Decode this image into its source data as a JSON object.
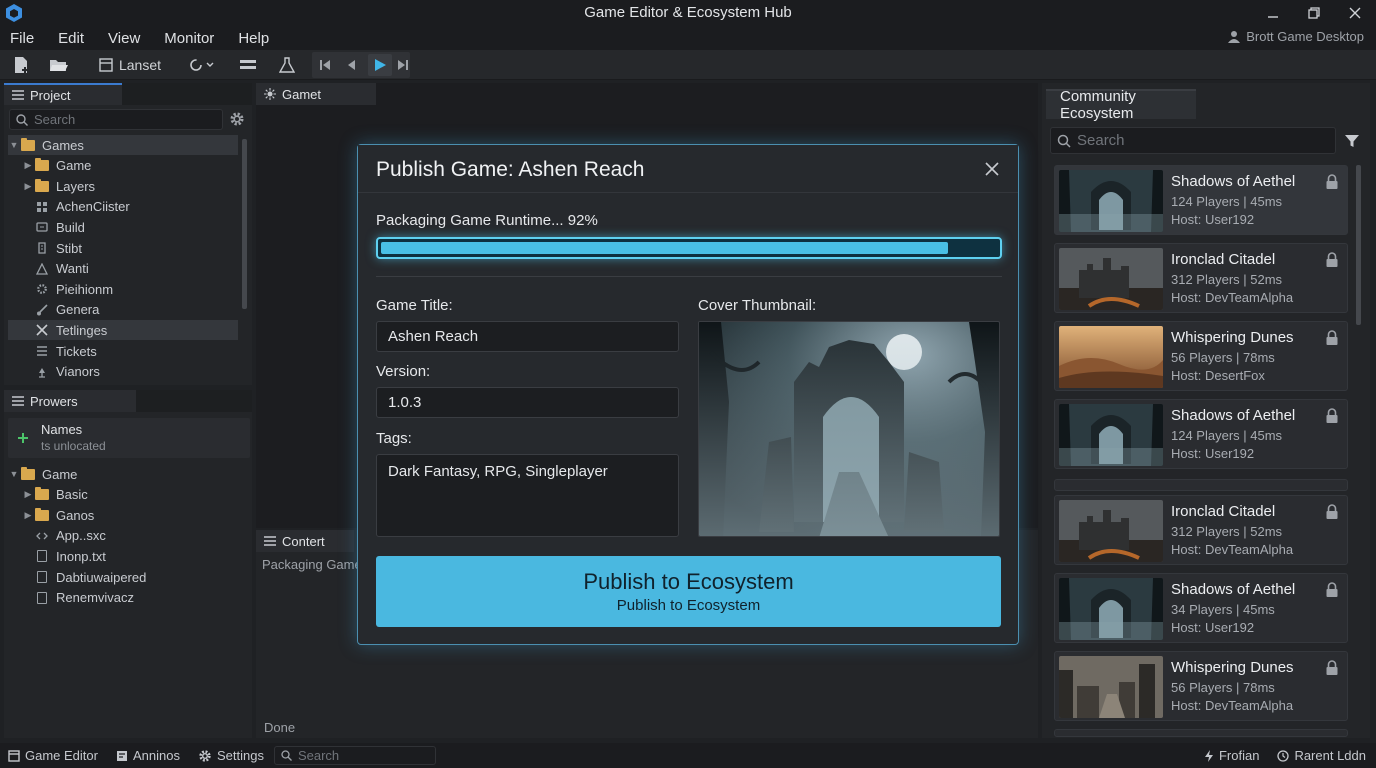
{
  "window": {
    "title": "Game Editor & Ecosystem Hub",
    "account": "Brott Game Desktop"
  },
  "menu": [
    "File",
    "Edit",
    "View",
    "Monitor",
    "Help"
  ],
  "toolbar": {
    "layout_label": "Lanset"
  },
  "project": {
    "tab": "Project",
    "search_placeholder": "Search",
    "tree": [
      {
        "label": "Games",
        "icon": "folder",
        "expanded": true,
        "selected": true
      },
      {
        "label": "Game",
        "icon": "folder"
      },
      {
        "label": "Layers",
        "icon": "folder"
      },
      {
        "label": "AchenCiister",
        "icon": "grid"
      },
      {
        "label": "Build",
        "icon": "build"
      },
      {
        "label": "Stibt",
        "icon": "script"
      },
      {
        "label": "Wanti",
        "icon": "warning"
      },
      {
        "label": "Pieihionm",
        "icon": "gear"
      },
      {
        "label": "Genera",
        "icon": "brush"
      },
      {
        "label": "Tetlinges",
        "icon": "tools",
        "selected": true
      },
      {
        "label": "Tickets",
        "icon": "list"
      },
      {
        "label": "Vianors",
        "icon": "lamp"
      }
    ]
  },
  "browser": {
    "tab": "Prowers",
    "names_card": {
      "title": "Names",
      "subtitle": "ts unlocated"
    },
    "tree": [
      {
        "label": "Game",
        "icon": "folder",
        "expanded": true
      },
      {
        "label": "Basic",
        "icon": "folder"
      },
      {
        "label": "Ganos",
        "icon": "folder"
      },
      {
        "label": "App..sxc",
        "icon": "code"
      },
      {
        "label": "Inonp.txt",
        "icon": "file"
      },
      {
        "label": "Dabtiuwaipered",
        "icon": "file"
      },
      {
        "label": "Renemvivacz",
        "icon": "file"
      }
    ]
  },
  "scene": {
    "tab": "Gamet"
  },
  "content": {
    "tab": "Contert",
    "log_line": "Packaging Game",
    "status": "Done"
  },
  "dialog": {
    "title": "Publish Game: Ashen Reach",
    "progress_label": "Packaging Game Runtime... 92%",
    "progress": 0.92,
    "game_title_label": "Game Title:",
    "game_title_value": "Ashen Reach",
    "version_label": "Version:",
    "version_value": "1.0.3",
    "tags_label": "Tags:",
    "tags_value": "Dark Fantasy, RPG, Singleplayer",
    "cover_label": "Cover Thumbnail:",
    "publish_label": "Publish to Ecosystem",
    "publish_sublabel": "Publish to Ecosystem"
  },
  "community": {
    "tab": "Community Ecosystem",
    "search_placeholder": "Search",
    "cards": [
      {
        "name": "Shadows of Aethel",
        "meta": "124 Players | 45ms",
        "host": "Host: User192",
        "thumb": "arch"
      },
      {
        "name": "Ironclad Citadel",
        "meta": "312 Players | 52ms",
        "host": "Host: DevTeamAlpha",
        "thumb": "castle"
      },
      {
        "name": "Whispering Dunes",
        "meta": "56 Players | 78ms",
        "host": "Host: DesertFox",
        "thumb": "dunes"
      },
      {
        "name": "Shadows of Aethel",
        "meta": "124 Players | 45ms",
        "host": "Host: User192",
        "thumb": "arch"
      },
      {
        "name": "Ironclad Citadel",
        "meta": "312 Players | 52ms",
        "host": "Host: DevTeamAlpha",
        "thumb": "castle"
      },
      {
        "name": "Shadows of Aethel",
        "meta": "34 Players | 45ms",
        "host": "Host: User192",
        "thumb": "arch"
      },
      {
        "name": "Whispering Dunes",
        "meta": "56 Players | 78ms",
        "host": "Host: DevTeamAlpha",
        "thumb": "ruins"
      }
    ]
  },
  "statusbar": {
    "game_editor": "Game Editor",
    "annotations": "Anninos",
    "settings": "Settings",
    "search_placeholder": "Search",
    "right1": "Frofian",
    "right2": "Rarent Lddn"
  },
  "colors": {
    "accent": "#49c0e6",
    "folder": "#d9a84e",
    "background": "#1f2124"
  }
}
